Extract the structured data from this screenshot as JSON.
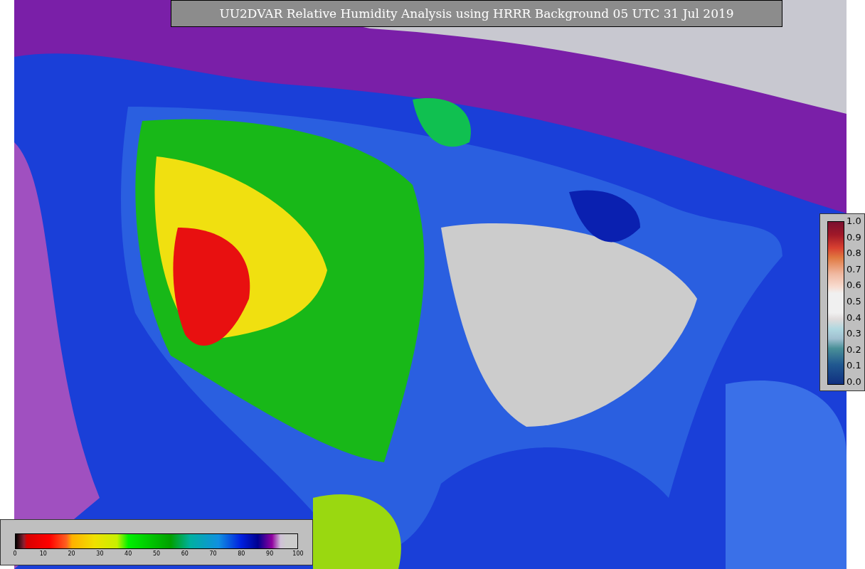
{
  "title": "UU2DVAR Relative Humidity Analysis using HRRR Background 05 UTC 31 Jul 2019",
  "humidity_colorbar": {
    "ticks": [
      "0",
      "10",
      "20",
      "30",
      "40",
      "50",
      "60",
      "70",
      "80",
      "90",
      "100"
    ]
  },
  "increment_colorbar": {
    "ticks": [
      "1.0",
      "0.9",
      "0.8",
      "0.7",
      "0.6",
      "0.5",
      "0.4",
      "0.3",
      "0.2",
      "0.1",
      "0.0"
    ]
  }
}
